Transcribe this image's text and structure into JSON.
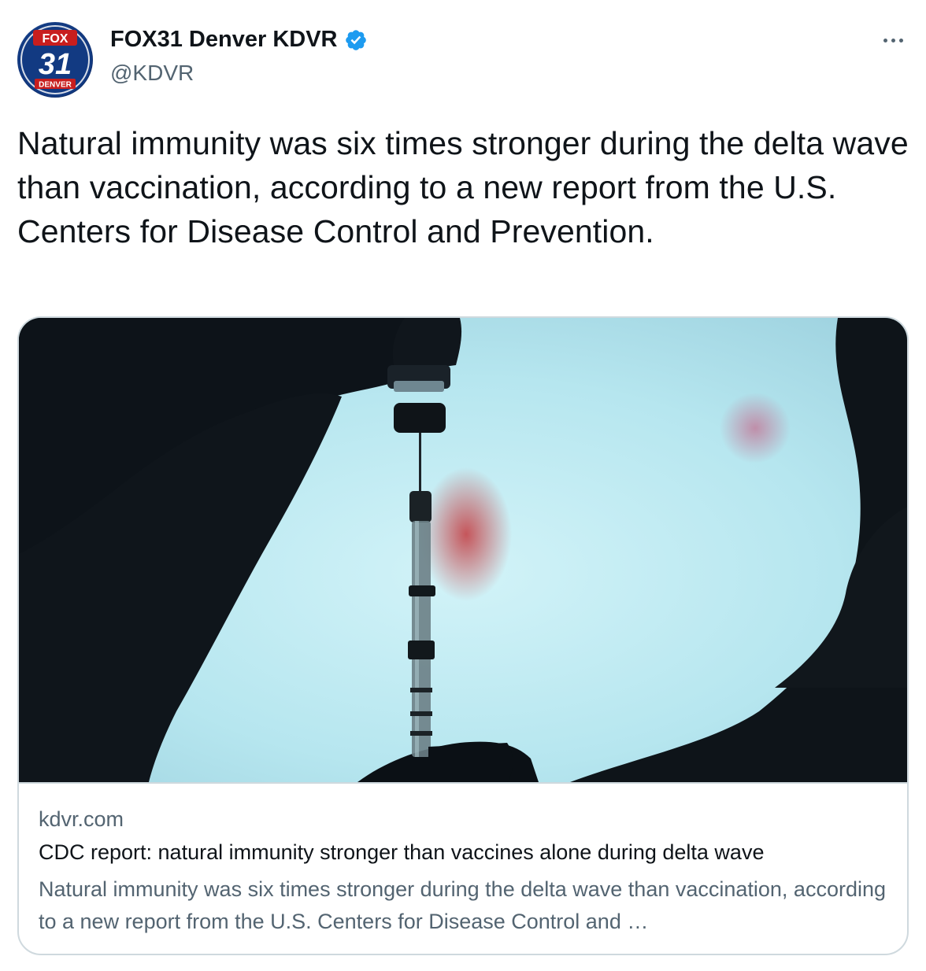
{
  "author": {
    "display_name": "FOX31 Denver KDVR",
    "handle": "@KDVR",
    "verified": true,
    "avatar": {
      "logo_top": "FOX",
      "logo_number": "31",
      "logo_bottom": "DENVER"
    }
  },
  "tweet": {
    "text": "Natural immunity was six times stronger during the delta wave than vaccination, according to a new report from the U.S. Centers for Disease Control and Prevention."
  },
  "card": {
    "image_icon": "syringe-vial-photo",
    "domain": "kdvr.com",
    "title": "CDC report: natural immunity stronger than vaccines alone during delta wave",
    "description": "Natural immunity was six times stronger during the delta wave than vaccination, according to a new report from the U.S. Centers for Disease Control and …"
  },
  "colors": {
    "text_primary": "#0f1419",
    "text_secondary": "#536471",
    "border": "#cfd9de",
    "verified_blue": "#1d9bf0",
    "photo_sky": "#bfe9f0"
  }
}
